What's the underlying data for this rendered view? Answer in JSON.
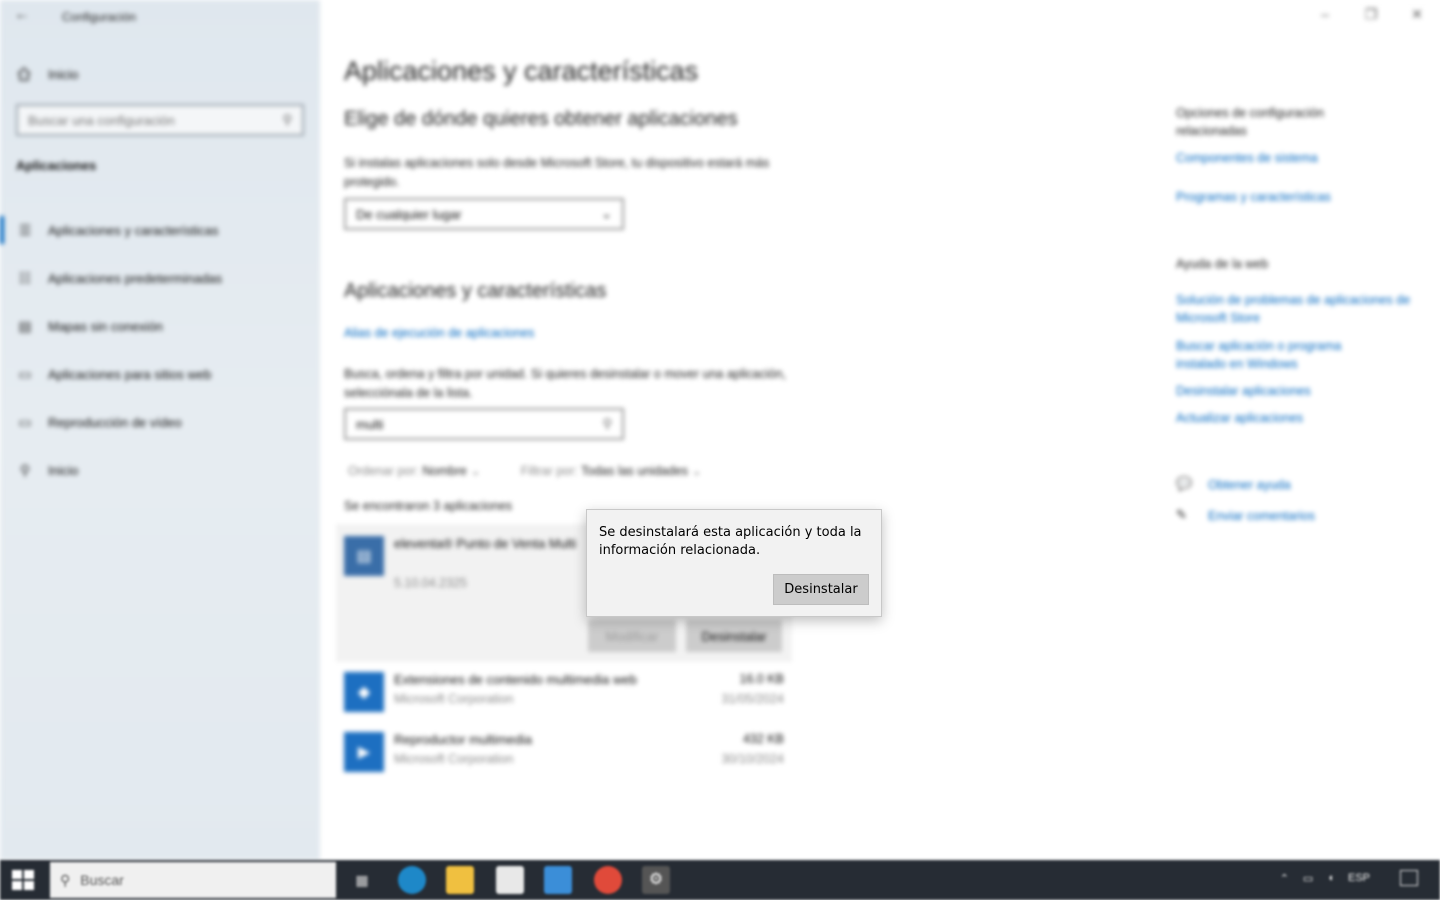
{
  "window": {
    "title": "Configuración",
    "controls": {
      "minimize": "–",
      "maximize": "❐",
      "close": "✕"
    }
  },
  "sidebar": {
    "home_label": "Inicio",
    "search_placeholder": "Buscar una configuración",
    "section": "Aplicaciones",
    "items": [
      {
        "label": "Aplicaciones y características",
        "icon": "apps-list-icon",
        "glyph": "☰",
        "active": true
      },
      {
        "label": "Aplicaciones predeterminadas",
        "icon": "default-apps-icon",
        "glyph": "☷",
        "active": false
      },
      {
        "label": "Mapas sin conexión",
        "icon": "map-icon",
        "glyph": "▤",
        "active": false
      },
      {
        "label": "Aplicaciones para sitios web",
        "icon": "web-apps-icon",
        "glyph": "▭",
        "active": false
      },
      {
        "label": "Reproducción de vídeo",
        "icon": "video-icon",
        "glyph": "▭",
        "active": false
      },
      {
        "label": "Inicio",
        "icon": "startup-icon",
        "glyph": "⚲",
        "active": false
      }
    ]
  },
  "main": {
    "title": "Aplicaciones y características",
    "source_heading": "Elige de dónde quieres obtener aplicaciones",
    "source_desc": "Si instalas aplicaciones solo desde Microsoft Store, tu dispositivo estará más protegido.",
    "source_value": "De cualquier lugar",
    "apps_heading": "Aplicaciones y características",
    "alias_link": "Alias de ejecución de aplicaciones",
    "filter_desc": "Busca, ordena y filtra por unidad. Si quieres desinstalar o mover una aplicación, selecciónala de la lista.",
    "filter_value": "multi",
    "sort_label": "Ordenar por:",
    "sort_value": "Nombre",
    "filter_label": "Filtrar por:",
    "filter_by_value": "Todas las unidades",
    "found_text": "Se encontraron 3 aplicaciones",
    "apps": [
      {
        "name": "eleventa® Punto de Venta Multi",
        "publisher": "",
        "version": "5.10.04.2325",
        "size": "",
        "date": ""
      },
      {
        "name": "Extensiones de contenido multimedia web",
        "publisher": "Microsoft Corporation",
        "size": "16.0 KB",
        "date": "31/05/2024"
      },
      {
        "name": "Reproductor multimedia",
        "publisher": "Microsoft Corporation",
        "size": "432 KB",
        "date": "30/10/2024"
      }
    ],
    "modify_btn": "Modificar",
    "uninstall_btn": "Desinstalar"
  },
  "related": {
    "heading": "Opciones de configuración relacionadas",
    "links": [
      "Componentes de sistema",
      "Programas y características"
    ],
    "help_heading": "Ayuda de la web",
    "help_links": [
      "Solución de problemas de aplicaciones de Microsoft Store",
      "Buscar aplicación o programa instalado en Windows",
      "Desinstalar aplicaciones",
      "Actualizar aplicaciones"
    ],
    "get_help": "Obtener ayuda",
    "feedback": "Enviar comentarios"
  },
  "popup": {
    "message": "Se desinstalará esta aplicación y toda la información relacionada.",
    "button": "Desinstalar"
  },
  "taskbar": {
    "search_label": "Buscar",
    "tray": [
      "ESP"
    ]
  }
}
